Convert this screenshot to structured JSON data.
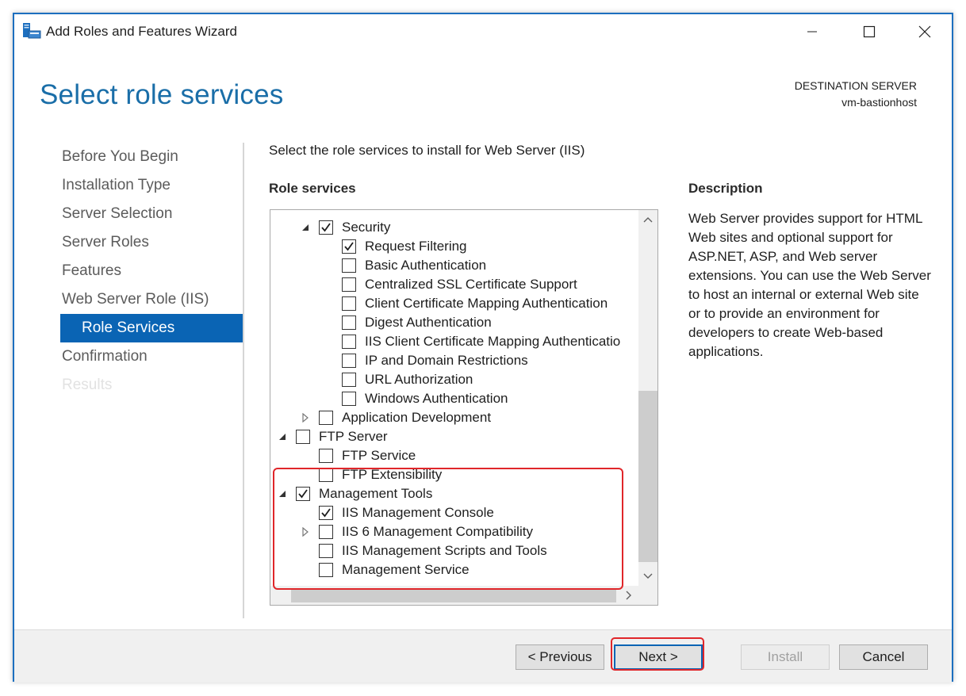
{
  "window": {
    "title": "Add Roles and Features Wizard"
  },
  "header": {
    "page_title": "Select role services",
    "destination_label": "DESTINATION SERVER",
    "destination_server": "vm-bastionhost"
  },
  "nav": {
    "items": [
      {
        "label": "Before You Begin",
        "state": "normal"
      },
      {
        "label": "Installation Type",
        "state": "normal"
      },
      {
        "label": "Server Selection",
        "state": "normal"
      },
      {
        "label": "Server Roles",
        "state": "normal"
      },
      {
        "label": "Features",
        "state": "normal"
      },
      {
        "label": "Web Server Role (IIS)",
        "state": "normal"
      },
      {
        "label": "Role Services",
        "state": "active"
      },
      {
        "label": "Confirmation",
        "state": "normal"
      },
      {
        "label": "Results",
        "state": "disabled"
      }
    ]
  },
  "main": {
    "instruction": "Select the role services to install for Web Server (IIS)",
    "role_services_label": "Role services",
    "description_label": "Description",
    "description_text": "Web Server provides support for HTML Web sites and optional support for ASP.NET, ASP, and Web server extensions. You can use the Web Server to host an internal or external Web site or to provide an environment for developers to create Web-based applications."
  },
  "tree": {
    "items": [
      {
        "label": "Security",
        "level": 1,
        "expander": "expanded",
        "checked": true
      },
      {
        "label": "Request Filtering",
        "level": 2,
        "expander": "none",
        "checked": true
      },
      {
        "label": "Basic Authentication",
        "level": 2,
        "expander": "none",
        "checked": false
      },
      {
        "label": "Centralized SSL Certificate Support",
        "level": 2,
        "expander": "none",
        "checked": false
      },
      {
        "label": "Client Certificate Mapping Authentication",
        "level": 2,
        "expander": "none",
        "checked": false
      },
      {
        "label": "Digest Authentication",
        "level": 2,
        "expander": "none",
        "checked": false
      },
      {
        "label": "IIS Client Certificate Mapping Authenticatio",
        "level": 2,
        "expander": "none",
        "checked": false
      },
      {
        "label": "IP and Domain Restrictions",
        "level": 2,
        "expander": "none",
        "checked": false
      },
      {
        "label": "URL Authorization",
        "level": 2,
        "expander": "none",
        "checked": false
      },
      {
        "label": "Windows Authentication",
        "level": 2,
        "expander": "none",
        "checked": false
      },
      {
        "label": "Application Development",
        "level": 1,
        "expander": "collapsed",
        "checked": false
      },
      {
        "label": "FTP Server",
        "level": 0,
        "expander": "expanded",
        "checked": false
      },
      {
        "label": "FTP Service",
        "level": 1,
        "expander": "none",
        "checked": false
      },
      {
        "label": "FTP Extensibility",
        "level": 1,
        "expander": "none",
        "checked": false
      },
      {
        "label": "Management Tools",
        "level": 0,
        "expander": "expanded",
        "checked": true
      },
      {
        "label": "IIS Management Console",
        "level": 1,
        "expander": "none",
        "checked": true
      },
      {
        "label": "IIS 6 Management Compatibility",
        "level": 1,
        "expander": "collapsed",
        "checked": false
      },
      {
        "label": "IIS Management Scripts and Tools",
        "level": 1,
        "expander": "none",
        "checked": false
      },
      {
        "label": "Management Service",
        "level": 1,
        "expander": "none",
        "checked": false
      }
    ]
  },
  "footer": {
    "previous_label": "< Previous",
    "next_label": "Next >",
    "install_label": "Install",
    "cancel_label": "Cancel"
  },
  "colors": {
    "accent": "#0a64b4",
    "title": "#1a6ea8",
    "highlight": "#e0262a"
  },
  "icons": {
    "app": "server-manager-icon",
    "minimize": "minimize-icon",
    "maximize": "maximize-icon",
    "close": "close-icon",
    "expanded": "triangle-expanded-icon",
    "collapsed": "triangle-collapsed-icon",
    "check": "checkmark-icon"
  }
}
